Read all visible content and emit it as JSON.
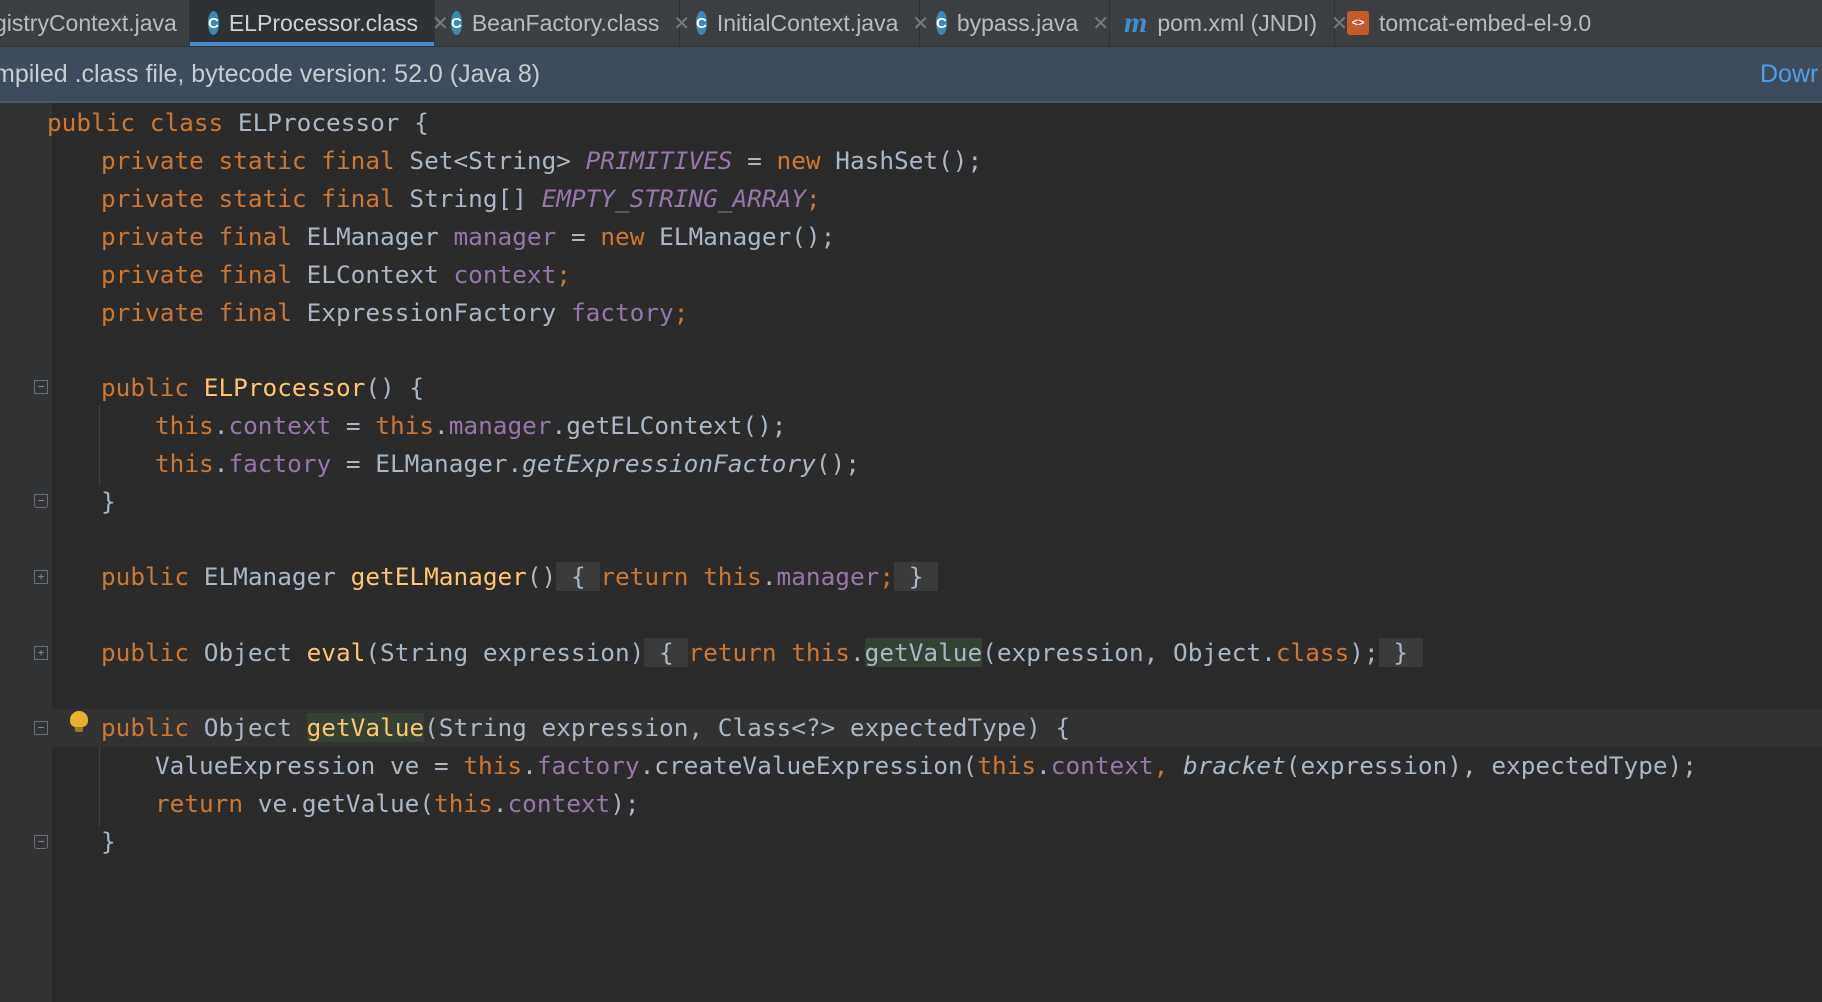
{
  "tabs": [
    {
      "label": "gistryContext.java",
      "icon": "java-class-icon",
      "active": false
    },
    {
      "label": "ELProcessor.class",
      "icon": "class-file-icon",
      "active": true
    },
    {
      "label": "BeanFactory.class",
      "icon": "class-file-icon",
      "active": false
    },
    {
      "label": "InitialContext.java",
      "icon": "java-class-icon",
      "active": false
    },
    {
      "label": "bypass.java",
      "icon": "runnable-class-icon",
      "active": false
    },
    {
      "label": "pom.xml (JNDI)",
      "icon": "maven-icon",
      "active": false
    },
    {
      "label": "tomcat-embed-el-9.0",
      "icon": "jar-archive-icon",
      "active": false
    }
  ],
  "notice": {
    "message": "mpiled .class file, bytecode version: 52.0 (Java 8)",
    "link": "Dowr"
  },
  "code": {
    "class_decl": [
      "public",
      "class",
      "ELProcessor",
      "{"
    ],
    "f1": [
      "private",
      "static",
      "final",
      "Set<String>",
      "PRIMITIVES",
      "=",
      "new",
      "HashSet();"
    ],
    "f2": [
      "private",
      "static",
      "final",
      "String[]",
      "EMPTY_STRING_ARRAY",
      ";"
    ],
    "f3": [
      "private",
      "final",
      "ELManager",
      "manager",
      "=",
      "new",
      "ELManager();"
    ],
    "f4": [
      "private",
      "final",
      "ELContext",
      "context",
      ";"
    ],
    "f5": [
      "private",
      "final",
      "ExpressionFactory",
      "factory",
      ";"
    ],
    "ctor": [
      "public",
      "ELProcessor",
      "() {"
    ],
    "ctor1": [
      "this",
      ".",
      "context",
      " = ",
      "this",
      ".",
      "manager",
      ".getELContext();"
    ],
    "ctor2": [
      "this",
      ".",
      "factory",
      " = ELManager.",
      "getExpressionFactory",
      "();"
    ],
    "close": "}",
    "m1": [
      "public",
      "ELManager",
      "getELManager",
      "()",
      "{",
      "return",
      "this",
      ".",
      "manager",
      ";",
      "}"
    ],
    "m2": [
      "public",
      "Object",
      "eval",
      "(String expression)",
      "{",
      "return",
      "this",
      ".",
      "getValue",
      "(expression, Object.",
      "class",
      ");",
      "}"
    ],
    "m3": [
      "public",
      "Object",
      "getValue",
      "(String expression, Class<?> expectedType) {"
    ],
    "m3a": [
      "ValueExpression ve = ",
      "this",
      ".",
      "factory",
      ".createValueExpression(",
      "this",
      ".",
      "context",
      ", ",
      "bracket",
      "(expression), expectedType);"
    ],
    "m3b": [
      "return",
      " ve.getValue(",
      "this",
      ".",
      "context",
      ");"
    ]
  },
  "colors": {
    "keyword": "#cc7832",
    "field": "#9876aa",
    "method_decl": "#ffc66d",
    "text": "#a9b7c6",
    "background": "#2b2b2b",
    "tab_underline": "#4a88c7",
    "link": "#4b9eea"
  }
}
